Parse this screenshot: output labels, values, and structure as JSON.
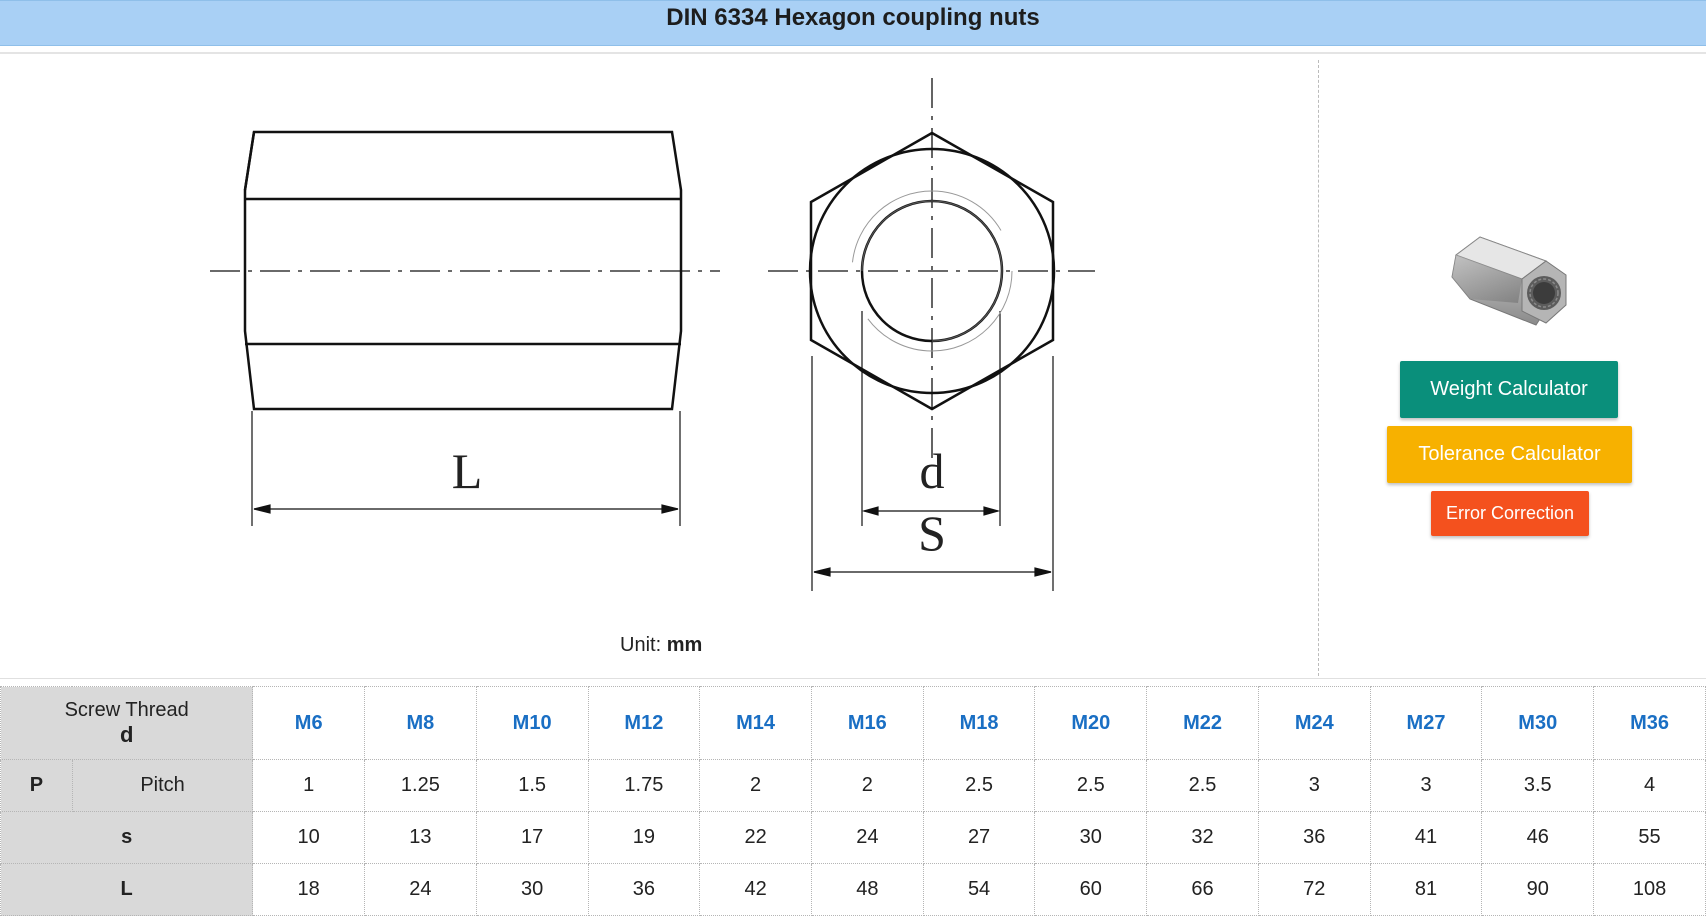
{
  "title": "DIN 6334 Hexagon coupling nuts",
  "drawing": {
    "labels": {
      "length": "L",
      "thread": "d",
      "width_across_flats": "S"
    }
  },
  "unit": {
    "prefix": "Unit:",
    "value": "mm"
  },
  "buttons": {
    "weight": "Weight Calculator",
    "tolerance": "Tolerance Calculator",
    "error": "Error Correction"
  },
  "colors": {
    "title_bar": "#a9d0f5",
    "weight_btn": "#0a8f7b",
    "tolerance_btn": "#f7b100",
    "error_btn": "#f4511e",
    "size_text": "#1a6fc4"
  },
  "table": {
    "header": {
      "label": "Screw Thread",
      "symbol": "d"
    },
    "sizes": [
      "M6",
      "M8",
      "M10",
      "M12",
      "M14",
      "M16",
      "M18",
      "M20",
      "M22",
      "M24",
      "M27",
      "M30",
      "M36"
    ],
    "rows": [
      {
        "symbol": "P",
        "label": "Pitch",
        "values": [
          "1",
          "1.25",
          "1.5",
          "1.75",
          "2",
          "2",
          "2.5",
          "2.5",
          "2.5",
          "3",
          "3",
          "3.5",
          "4"
        ]
      },
      {
        "symbol": "s",
        "label": "",
        "values": [
          "10",
          "13",
          "17",
          "19",
          "22",
          "24",
          "27",
          "30",
          "32",
          "36",
          "41",
          "46",
          "55"
        ]
      },
      {
        "symbol": "L",
        "label": "",
        "values": [
          "18",
          "24",
          "30",
          "36",
          "42",
          "48",
          "54",
          "60",
          "66",
          "72",
          "81",
          "90",
          "108"
        ]
      }
    ]
  }
}
